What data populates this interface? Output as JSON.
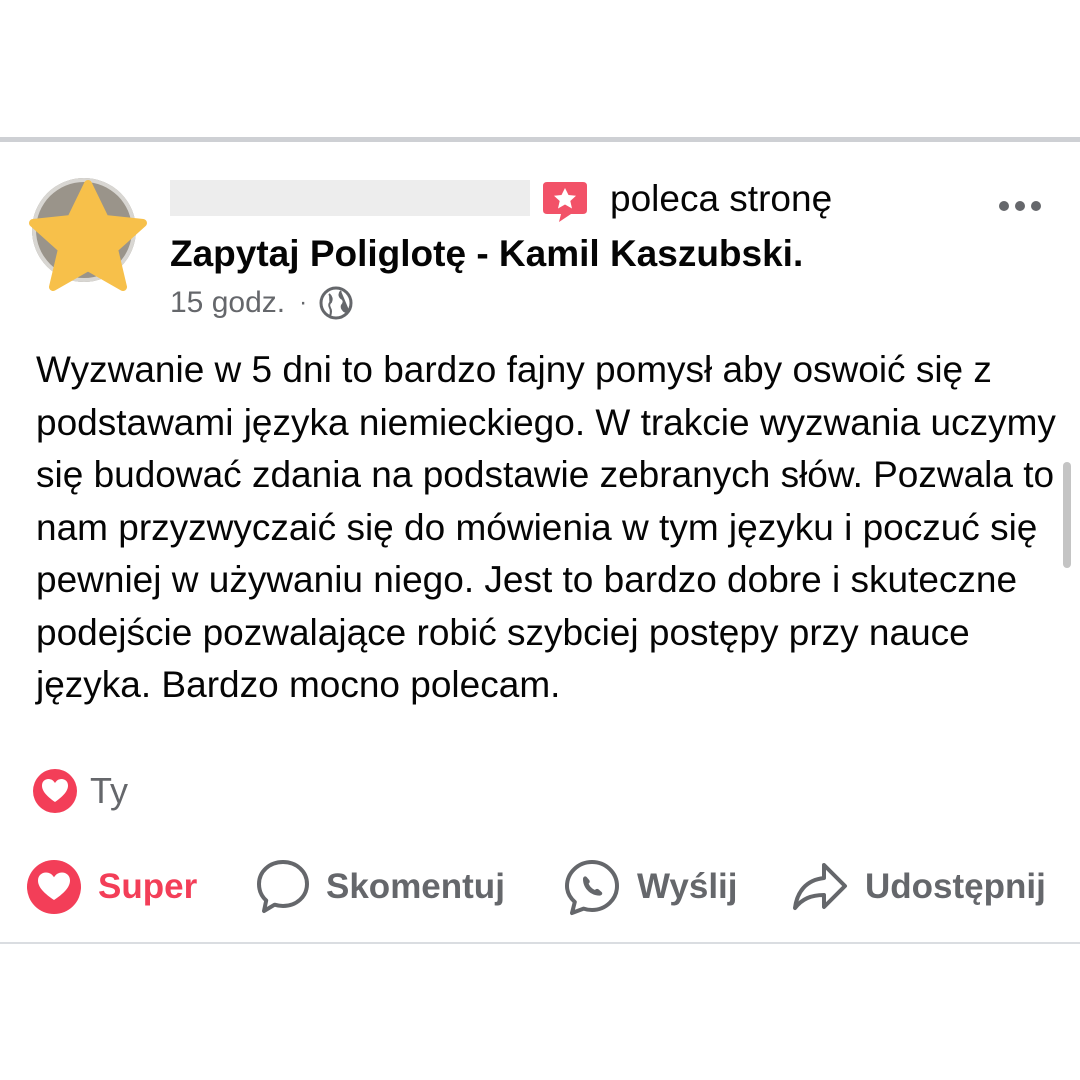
{
  "post": {
    "action_text": "poleca stronę",
    "page_name": "Zapytaj Poliglotę - Kamil Kaszubski.",
    "time": "15 godz.",
    "separator": "·",
    "body": "Wyzwanie w 5 dni to bardzo fajny pomysł aby oswoić się z podstawami języka niemieckiego. W trakcie wyzwania uczymy się budować zdania na podstawie zebranych słów. Pozwala to nam przyzwyczaić się do mówienia w tym języku i poczuć się pewniej w używaniu niego. Jest to bardzo dobre i skuteczne podejście pozwalające robić szybciej postępy przy nauce języka. Bardzo mocno polecam."
  },
  "reactions": {
    "count_label": "Ty",
    "icon": "heart-reaction-icon"
  },
  "actions": {
    "super": "Super",
    "comment": "Skomentuj",
    "send": "Wyślij",
    "share": "Udostępnij"
  },
  "icons": {
    "star": "star-icon",
    "recommend": "recommend-star-icon",
    "more": "more-options-icon",
    "globe": "globe-icon",
    "comment": "comment-bubble-icon",
    "send": "messenger-icon",
    "share": "share-arrow-icon"
  },
  "colors": {
    "super_red": "#f33e58",
    "recommend_red": "#f25268",
    "star_yellow": "#f7c04a",
    "secondary_text": "#65676b"
  }
}
